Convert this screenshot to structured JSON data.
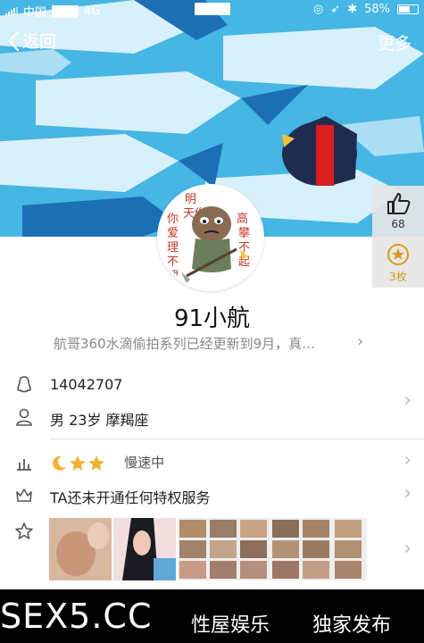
{
  "status_bar": {
    "carrier": "中国",
    "network": "4G",
    "battery": "58%"
  },
  "nav": {
    "back_label": "返回",
    "more_label": "更多"
  },
  "side": {
    "likes": "68",
    "medals": "3枚"
  },
  "profile": {
    "nickname": "91小航",
    "signature": "航哥360水滴偷拍系列已经更新到9月，真…"
  },
  "info": {
    "qq_number": "14042707",
    "basic": "男 23岁 摩羯座",
    "level_status": "慢速中",
    "privilege": "TA还未开通任何特权服务"
  },
  "footer": {
    "logo": "SEX5.CC",
    "link1": "性屋娱乐",
    "link2": "独家发布"
  },
  "colors": {
    "banner_blue": "#46b6e4",
    "accent": "#d89a1b"
  }
}
